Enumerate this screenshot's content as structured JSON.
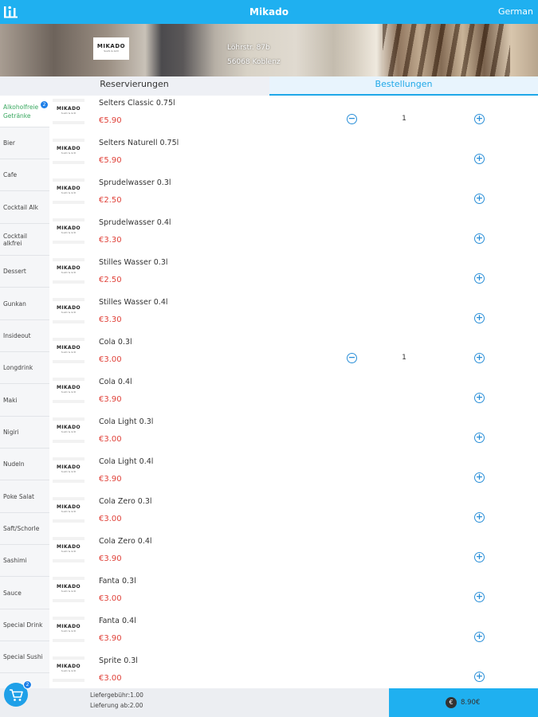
{
  "header": {
    "title": "Mikado",
    "language": "German"
  },
  "restaurant": {
    "logo_text": "MIKADO",
    "logo_sub": "Sushi & Grill",
    "address_line1": "Löhrstr. 87b",
    "address_line2": "56068 Koblenz"
  },
  "tabs": [
    {
      "label": "Reservierungen",
      "active": false
    },
    {
      "label": "Bestellungen",
      "active": true
    }
  ],
  "categories": [
    {
      "label": "Alkoholfreie Getränke",
      "selected": true,
      "badge": "2"
    },
    {
      "label": "Bier"
    },
    {
      "label": "Cafe"
    },
    {
      "label": "Cocktail Alk"
    },
    {
      "label": "Cocktail alkfrei"
    },
    {
      "label": "Dessert"
    },
    {
      "label": "Gunkan"
    },
    {
      "label": "Insideout"
    },
    {
      "label": "Longdrink"
    },
    {
      "label": "Maki"
    },
    {
      "label": "Nigiri"
    },
    {
      "label": "Nudeln"
    },
    {
      "label": "Poke Salat"
    },
    {
      "label": "Saft/Schorle"
    },
    {
      "label": "Sashimi"
    },
    {
      "label": "Sauce"
    },
    {
      "label": "Special Drink"
    },
    {
      "label": "Special Sushi"
    }
  ],
  "items": [
    {
      "name": "Selters Classic 0.75l",
      "price": "€5.90",
      "qty": "1"
    },
    {
      "name": "Selters Naturell 0.75l",
      "price": "€5.90",
      "qty": ""
    },
    {
      "name": "Sprudelwasser 0.3l",
      "price": "€2.50",
      "qty": ""
    },
    {
      "name": "Sprudelwasser 0.4l",
      "price": "€3.30",
      "qty": ""
    },
    {
      "name": "Stilles Wasser 0.3l",
      "price": "€2.50",
      "qty": ""
    },
    {
      "name": "Stilles Wasser 0.4l",
      "price": "€3.30",
      "qty": ""
    },
    {
      "name": "Cola 0.3l",
      "price": "€3.00",
      "qty": "1"
    },
    {
      "name": "Cola 0.4l",
      "price": "€3.90",
      "qty": ""
    },
    {
      "name": "Cola Light 0.3l",
      "price": "€3.00",
      "qty": ""
    },
    {
      "name": "Cola Light 0.4l",
      "price": "€3.90",
      "qty": ""
    },
    {
      "name": "Cola Zero 0.3l",
      "price": "€3.00",
      "qty": ""
    },
    {
      "name": "Cola Zero 0.4l",
      "price": "€3.90",
      "qty": ""
    },
    {
      "name": "Fanta 0.3l",
      "price": "€3.00",
      "qty": ""
    },
    {
      "name": "Fanta 0.4l",
      "price": "€3.90",
      "qty": ""
    },
    {
      "name": "Sprite 0.3l",
      "price": "€3.00",
      "qty": ""
    }
  ],
  "footer": {
    "cart_count": "2",
    "delivery_fee": "Liefergebühr:1.00",
    "min_order": "Lieferung ab:2.00",
    "total": "8.90€",
    "total_icon": "euro-coin-icon"
  },
  "colors": {
    "accent": "#1fb0f0",
    "price": "#e0423a",
    "selected_category": "#3aa860"
  }
}
